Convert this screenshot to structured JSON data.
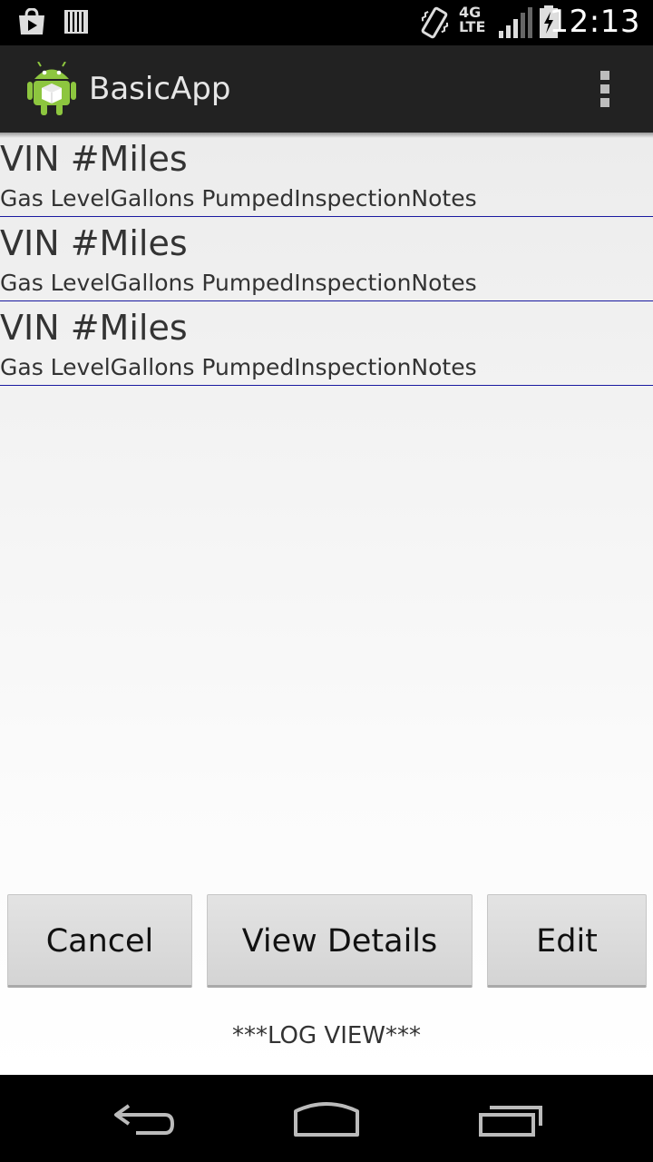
{
  "status_bar": {
    "time": "12:13",
    "network": "4G LTE",
    "icons": [
      "play-store-icon",
      "barcode-icon",
      "vibrate-icon",
      "signal-icon",
      "battery-charging-icon"
    ]
  },
  "action_bar": {
    "title": "BasicApp",
    "app_icon": "android-icon",
    "overflow_icon": "overflow-menu-icon"
  },
  "list": {
    "items": [
      {
        "title": "VIN #Miles",
        "subtitle": "Gas LevelGallons PumpedInspectionNotes"
      },
      {
        "title": "VIN #Miles",
        "subtitle": "Gas LevelGallons PumpedInspectionNotes"
      },
      {
        "title": "VIN #Miles",
        "subtitle": "Gas LevelGallons PumpedInspectionNotes"
      }
    ]
  },
  "buttons": {
    "cancel": "Cancel",
    "view_details": "View Details",
    "edit": "Edit"
  },
  "footer": {
    "log_view": "***LOG VIEW***"
  },
  "nav_bar": {
    "icons": [
      "back-icon",
      "home-icon",
      "recents-icon"
    ]
  },
  "colors": {
    "action_bar": "#222222",
    "divider": "#1a1aa0",
    "button": "#d8d8d8"
  }
}
